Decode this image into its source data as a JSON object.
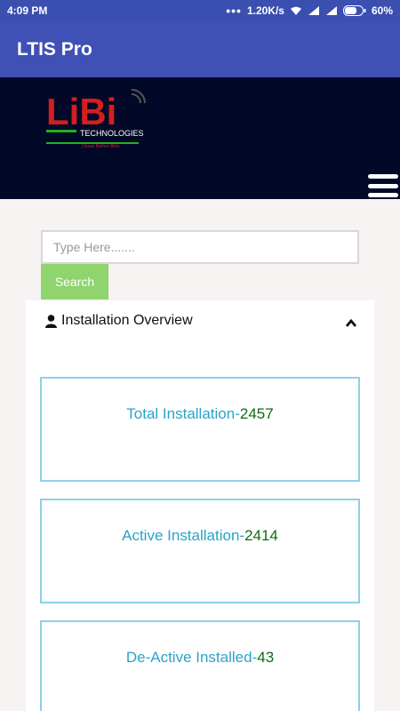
{
  "status_bar": {
    "time": "4:09 PM",
    "network_speed": "1.20K/s",
    "battery": "60%",
    "icons": [
      "dots-icon",
      "wifi-icon",
      "signal-icon",
      "signal-icon",
      "battery-icon"
    ]
  },
  "app_bar": {
    "title": "LTIS Pro"
  },
  "banner": {
    "logo_text": "LiBi",
    "logo_subtext": "TECHNOLOGIES",
    "logo_tagline": "Chase Before Blink",
    "menu_icon": "hamburger-menu-icon"
  },
  "search": {
    "placeholder": "Type Here.......",
    "button_label": "Search"
  },
  "overview": {
    "title": "Installation Overview",
    "icon": "user-icon",
    "toggle_icon": "chevron-up-icon",
    "cards": [
      {
        "label": "Total Installation-",
        "value": "2457"
      },
      {
        "label": "Active Installation-",
        "value": "2414"
      },
      {
        "label": "De-Active Installed-",
        "value": "43"
      }
    ]
  },
  "colors": {
    "status_bar": "#3b4fb0",
    "app_bar": "#3f51b5",
    "banner": "#020827",
    "search_button": "#8fd46c",
    "card_border": "#8fd0e8",
    "card_label": "#2aa3c9",
    "card_value": "#0e6b0e"
  }
}
